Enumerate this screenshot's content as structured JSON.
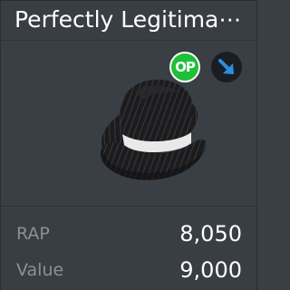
{
  "item": {
    "title": "Perfectly Legitima⋯",
    "badges": {
      "op_text": "OP",
      "op_color": "#1fbf3a",
      "projected_icon": "arrow-down-right-icon",
      "projected_color": "#2a8fe0"
    },
    "thumbnail_icon": "fedora-hat-image"
  },
  "stats": {
    "rap_label": "RAP",
    "rap_value": "8,050",
    "value_label": "Value",
    "value_value": "9,000"
  }
}
